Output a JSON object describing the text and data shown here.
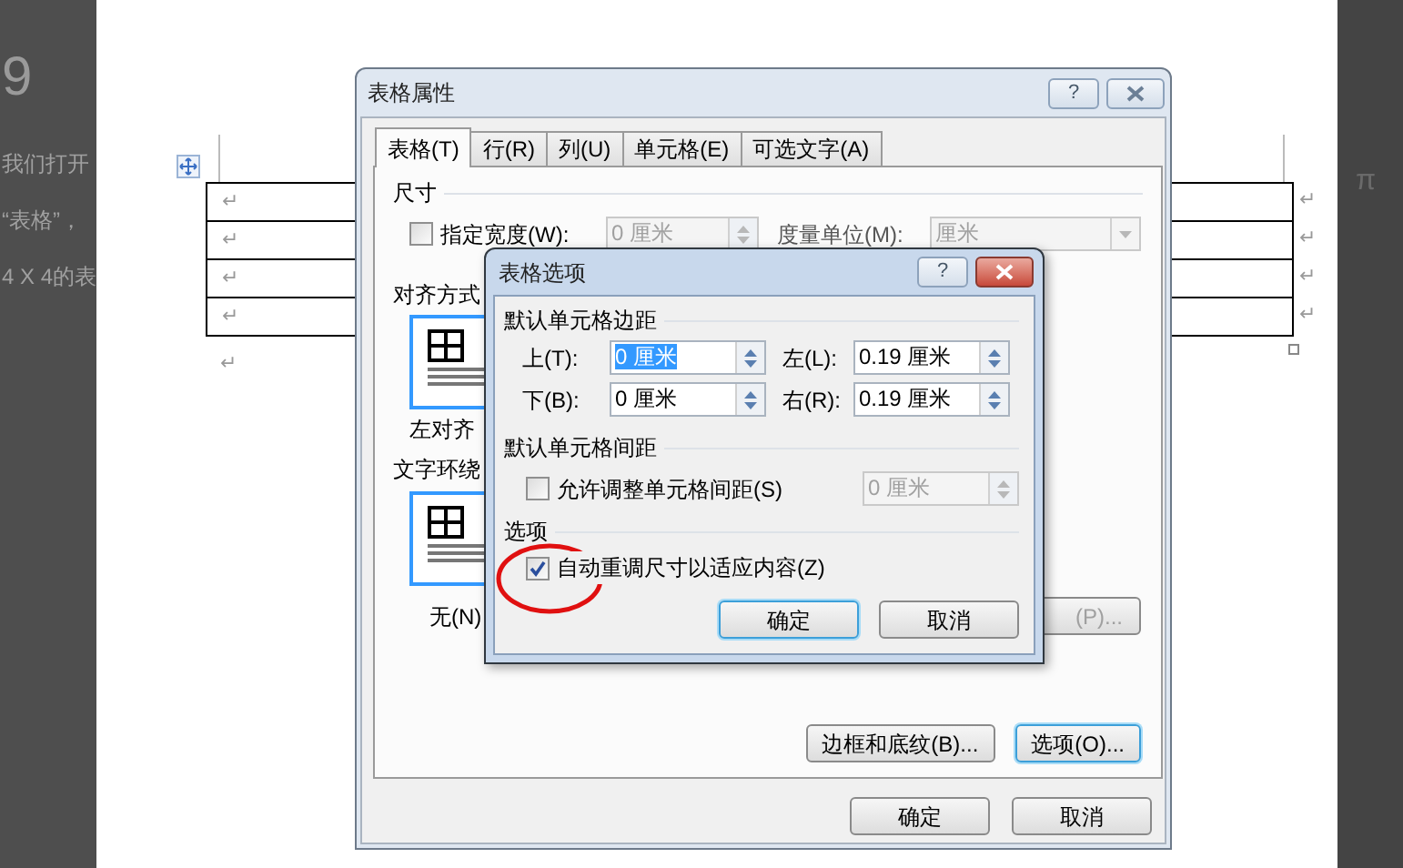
{
  "background_left": {
    "heading": "9",
    "lines": [
      "我们打开",
      "“表格”，",
      "4 X 4的表"
    ]
  },
  "background_right": {
    "symbol": "π"
  },
  "document": {
    "table": {
      "rows": [
        {
          "cell_mark": "↵",
          "row_end_mark": "↵"
        },
        {
          "cell_mark": "↵",
          "row_end_mark": "↵"
        },
        {
          "cell_mark": "↵",
          "row_end_mark": "↵"
        },
        {
          "cell_mark": "↵",
          "row_end_mark": "↵"
        }
      ]
    },
    "paragraph_mark": "↵"
  },
  "table_properties_dialog": {
    "title": "表格属性",
    "help": "?",
    "tabs": [
      {
        "label": "表格(T)",
        "selected": true
      },
      {
        "label": "行(R)",
        "selected": false
      },
      {
        "label": "列(U)",
        "selected": false
      },
      {
        "label": "单元格(E)",
        "selected": false
      },
      {
        "label": "可选文字(A)",
        "selected": false
      }
    ],
    "size": {
      "heading": "尺寸",
      "preferred_width": {
        "label": "指定宽度(W):",
        "checked": false,
        "value": "0 厘米"
      },
      "unit": {
        "label": "度量单位(M):",
        "value": "厘米"
      }
    },
    "alignment": {
      "heading": "对齐方式",
      "options": [
        {
          "label": "左对齐",
          "selected": true
        }
      ]
    },
    "text_wrapping": {
      "heading": "文字环绕",
      "options": [
        {
          "label": "无(N)",
          "selected": true
        }
      ],
      "positioning_button": {
        "label": "(P)...",
        "disabled": true
      }
    },
    "buttons": [
      {
        "label": "边框和底纹(B)...",
        "focused": false
      },
      {
        "label": "选项(O)...",
        "focused": true
      }
    ],
    "footer_buttons": [
      "确定",
      "取消"
    ]
  },
  "table_options_dialog": {
    "title": "表格选项",
    "help": "?",
    "margins_heading": "默认单元格边距",
    "margins": [
      {
        "label": "上(T):",
        "value": "0 厘米",
        "selected": true
      },
      {
        "label": "左(L):",
        "value": "0.19 厘米",
        "selected": false
      },
      {
        "label": "下(B):",
        "value": "0 厘米",
        "selected": false
      },
      {
        "label": "右(R):",
        "value": "0.19 厘米",
        "selected": false
      }
    ],
    "spacing_heading": "默认单元格间距",
    "allow_spacing": {
      "label": "允许调整单元格间距(S)",
      "checked": false,
      "value": "0 厘米"
    },
    "options_heading": "选项",
    "auto_resize": {
      "label": "自动重调尺寸以适应内容(Z)",
      "checked": true
    },
    "buttons": [
      {
        "label": "确定",
        "default": true
      },
      {
        "label": "取消",
        "default": false
      }
    ]
  }
}
